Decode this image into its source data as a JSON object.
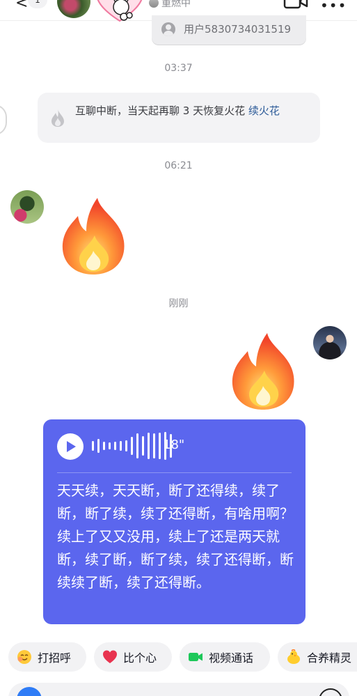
{
  "header": {
    "back_label": "<",
    "unread_count": "1",
    "status_text": "重燃中"
  },
  "quoted_card": {
    "user_name": "用户5830734031519"
  },
  "timestamps": {
    "t1": "03:37",
    "t2": "06:21",
    "t3": "刚刚"
  },
  "system_notice": {
    "text": "互聊中断，当天起再聊 3 天恢复火花 ",
    "link": "续火花"
  },
  "voice_message": {
    "duration": "18\"",
    "transcript": "天天续，天天断，断了还得续，续了断，断了续，续了还得断，有啥用啊？续上了又又没用，续上了还是两天就断，续了断，断了续，续了还得断，断续续了断，续了还得断。"
  },
  "quick_replies": [
    {
      "label": "打招呼",
      "icon": "smile-wave-icon"
    },
    {
      "label": "比个心",
      "icon": "heart-icon"
    },
    {
      "label": "视频通话",
      "icon": "video-call-icon"
    },
    {
      "label": "合养精灵",
      "icon": "chick-sprite-icon"
    }
  ],
  "colors": {
    "voice_card": "#5b66ee",
    "notice_link": "#2e5c99",
    "heart": "#e8334f",
    "video_green": "#1ec85a"
  }
}
